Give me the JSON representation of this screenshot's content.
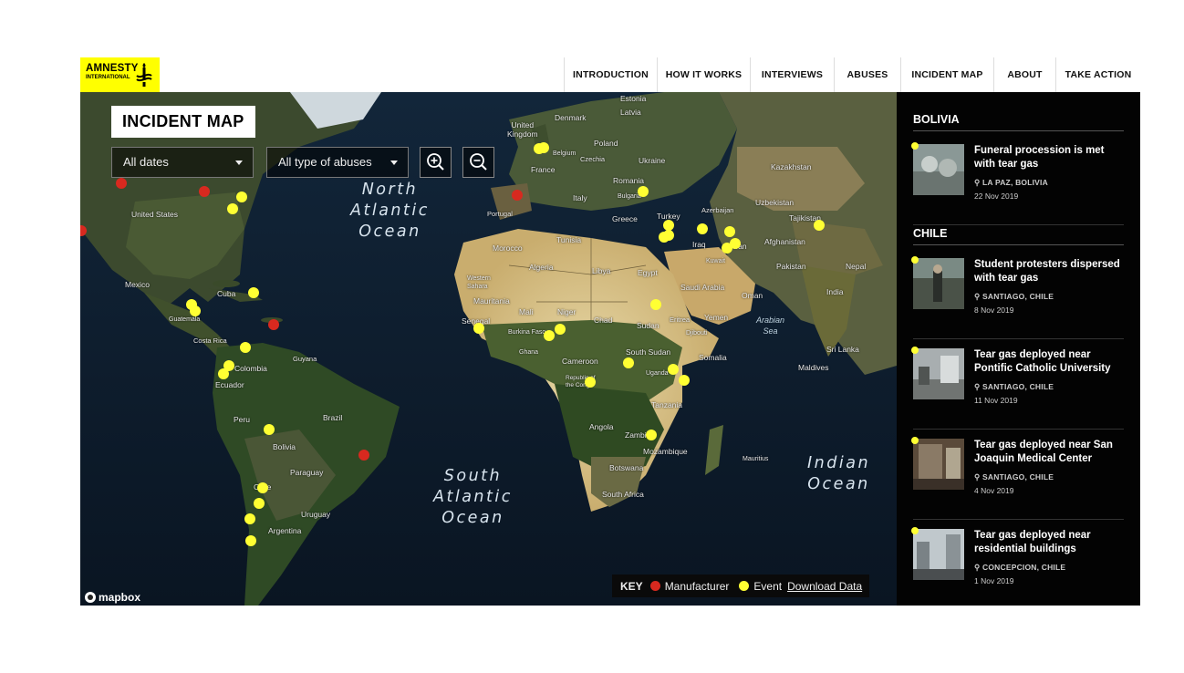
{
  "brand": {
    "line1": "AMNESTY",
    "line2": "INTERNATIONAL",
    "color": "#ffff00"
  },
  "nav": [
    {
      "label": "INTRODUCTION"
    },
    {
      "label": "HOW IT WORKS"
    },
    {
      "label": "INTERVIEWS"
    },
    {
      "label": "ABUSES"
    },
    {
      "label": "INCIDENT MAP"
    },
    {
      "label": "ABOUT"
    },
    {
      "label": "TAKE ACTION"
    }
  ],
  "map": {
    "title": "INCIDENT MAP",
    "date_filter": "All dates",
    "abuse_filter": "All type of abuses",
    "zoom_in": "zoom-in-icon",
    "zoom_out": "zoom-out-icon",
    "attribution": "mapbox",
    "oceans": {
      "north_atlantic": "North\nAtlantic\nOcean",
      "south_atlantic": "South\nAtlantic\nOcean",
      "indian": "Indian\nOcean",
      "arabian_sea": "Arabian\nSea"
    },
    "labels": {
      "estonia": "Estonia",
      "latvia": "Latvia",
      "denmark": "Denmark",
      "uk": "United\nKingdom",
      "belgium": "Belgium",
      "poland": "Poland",
      "czechia": "Czechia",
      "ukraine": "Ukraine",
      "france": "France",
      "romania": "Romania",
      "kazakhstan": "Kazakhstan",
      "portugal": "Portugal",
      "italy": "Italy",
      "bulgaria": "Bulgaria",
      "uzbekistan": "Uzbekistan",
      "greece": "Greece",
      "turkey": "Turkey",
      "azerbaijan": "Azerbaijan",
      "tajikistan": "Tajikistan",
      "united_states": "United States",
      "tunisia": "Tunisia",
      "morocco": "Morocco",
      "iraq": "Iraq",
      "iran": "Iran",
      "afghanistan": "Afghanistan",
      "kuwait": "Kuwait",
      "algeria": "Algeria",
      "libya": "Libya",
      "egypt": "Egypt",
      "pakistan": "Pakistan",
      "nepal": "Nepal",
      "western_sahara": "Western\nSahara",
      "saudi_arabia": "Saudi Arabia",
      "oman": "Oman",
      "india": "India",
      "mexico": "Mexico",
      "cuba": "Cuba",
      "mauritania": "Mauritania",
      "mali": "Mali",
      "niger": "Niger",
      "sudan": "Sudan",
      "chad": "Chad",
      "eritrea": "Eritrea",
      "yemen": "Yemen",
      "guatemala": "Guatemala",
      "senegal": "Senegal",
      "burkina_faso": "Burkina Faso",
      "djibouti": "Djibouti",
      "costa_rica": "Costa Rica",
      "ghana": "Ghana",
      "guyana": "Guyana",
      "south_sudan": "South Sudan",
      "sri_lanka": "Sri Lanka",
      "somalia": "Somalia",
      "colombia": "Colombia",
      "cameroon": "Cameroon",
      "maldives": "Maldives",
      "ecuador": "Ecuador",
      "uganda": "Uganda",
      "congo": "Republic of\nthe Congo",
      "tanzania": "Tanzania",
      "peru": "Peru",
      "brazil": "Brazil",
      "angola": "Angola",
      "bolivia": "Bolivia",
      "zambia": "Zambia",
      "mozambique": "Mozambique",
      "mauritius": "Mauritius",
      "paraguay": "Paraguay",
      "botswana": "Botswana",
      "chile": "Chile",
      "south_africa": "South Africa",
      "uruguay": "Uruguay",
      "argentina": "Argentina"
    },
    "colors": {
      "event": "#ffff33",
      "manufacturer": "#d8291f"
    },
    "key": {
      "title": "KEY",
      "manufacturer": "Manufacturer",
      "event": "Event",
      "download": "Download Data"
    }
  },
  "panel": {
    "sections": [
      {
        "country": "BOLIVIA",
        "incidents": [
          {
            "title": "Funeral procession is met with tear gas",
            "place": "LA PAZ, BOLIVIA",
            "date": "22 Nov 2019"
          }
        ]
      },
      {
        "country": "CHILE",
        "incidents": [
          {
            "title": "Student protesters dispersed with tear gas",
            "place": "SANTIAGO, CHILE",
            "date": "8 Nov 2019"
          },
          {
            "title": "Tear gas deployed near Pontific Catholic University",
            "place": "SANTIAGO, CHILE",
            "date": "11 Nov 2019"
          },
          {
            "title": "Tear gas deployed near San Joaquin Medical Center",
            "place": "SANTIAGO, CHILE",
            "date": "4 Nov 2019"
          },
          {
            "title": "Tear gas deployed near residential buildings",
            "place": "CONCEPCION, CHILE",
            "date": "1 Nov 2019"
          }
        ]
      }
    ]
  }
}
